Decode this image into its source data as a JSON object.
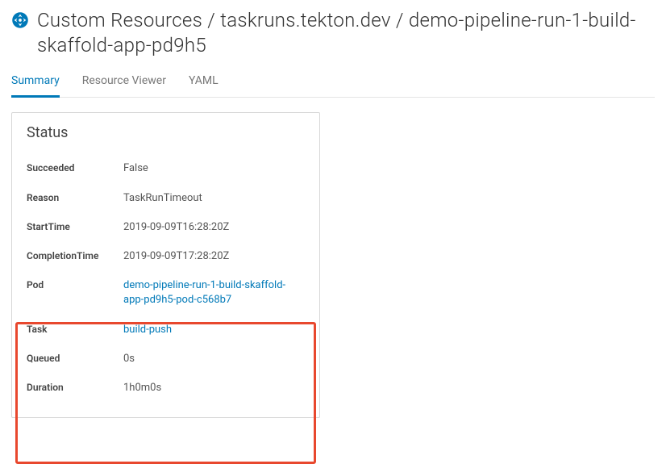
{
  "header": {
    "breadcrumb": "Custom Resources / taskruns.tekton.dev / demo-pipeline-run-1-build-skaffold-app-pd9h5"
  },
  "tabs": [
    {
      "label": "Summary",
      "active": true
    },
    {
      "label": "Resource Viewer",
      "active": false
    },
    {
      "label": "YAML",
      "active": false
    }
  ],
  "card": {
    "title": "Status",
    "rows": [
      {
        "label": "Succeeded",
        "value": "False",
        "link": false
      },
      {
        "label": "Reason",
        "value": "TaskRunTimeout",
        "link": false
      },
      {
        "label": "StartTime",
        "value": "2019-09-09T16:28:20Z",
        "link": false
      },
      {
        "label": "CompletionTime",
        "value": "2019-09-09T17:28:20Z",
        "link": false
      },
      {
        "label": "Pod",
        "value": "demo-pipeline-run-1-build-skaffold-app-pd9h5-pod-c568b7",
        "link": true
      },
      {
        "label": "Task",
        "value": "build-push",
        "link": true
      },
      {
        "label": "Queued",
        "value": "0s",
        "link": false
      },
      {
        "label": "Duration",
        "value": "1h0m0s",
        "link": false
      }
    ]
  }
}
